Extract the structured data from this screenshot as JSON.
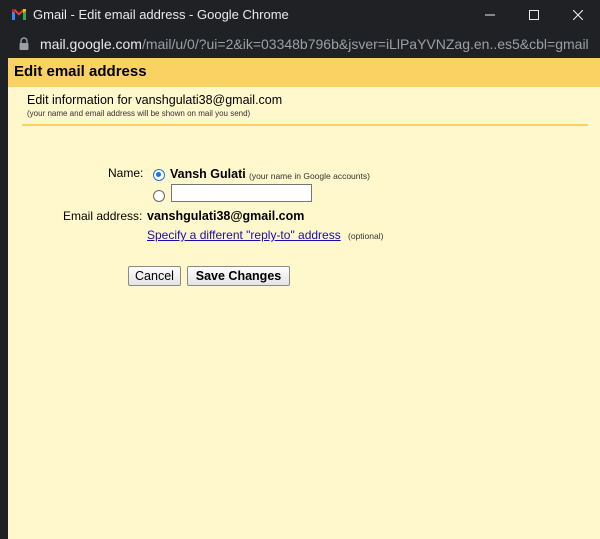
{
  "window": {
    "title": "Gmail - Edit email address - Google Chrome",
    "logo_icon": "gmail-logo-icon",
    "controls": [
      "minimize-icon",
      "maximize-icon",
      "close-icon"
    ]
  },
  "address_bar": {
    "host": "mail.google.com",
    "path": "/mail/u/0/?ui=2&ik=03348b796b&jsver=iLlPaYVNZag.en..es5&cbl=gmail....",
    "icon": "lock-icon"
  },
  "dialog": {
    "title": "Edit email address",
    "info_heading": "Edit information for vanshgulati38@gmail.com",
    "info_subtext": "(your name and email address will be shown on mail you send)",
    "name_label": "Name:",
    "name_option_current": "Vansh Gulati",
    "name_option_note": "(your name in Google accounts)",
    "name_option_custom_value": "",
    "selected_option": "current",
    "email_label": "Email address:",
    "email_value": "vanshgulati38@gmail.com",
    "reply_to_link": "Specify a different \"reply-to\" address",
    "reply_to_note": "(optional)",
    "cancel_label": "Cancel",
    "save_label": "Save Changes"
  },
  "colors": {
    "chrome_dark": "#202124",
    "header_band": "#fad163",
    "content_bg": "#fff8cc",
    "link": "#1a0dab",
    "radio_accent": "#1a73e8"
  }
}
